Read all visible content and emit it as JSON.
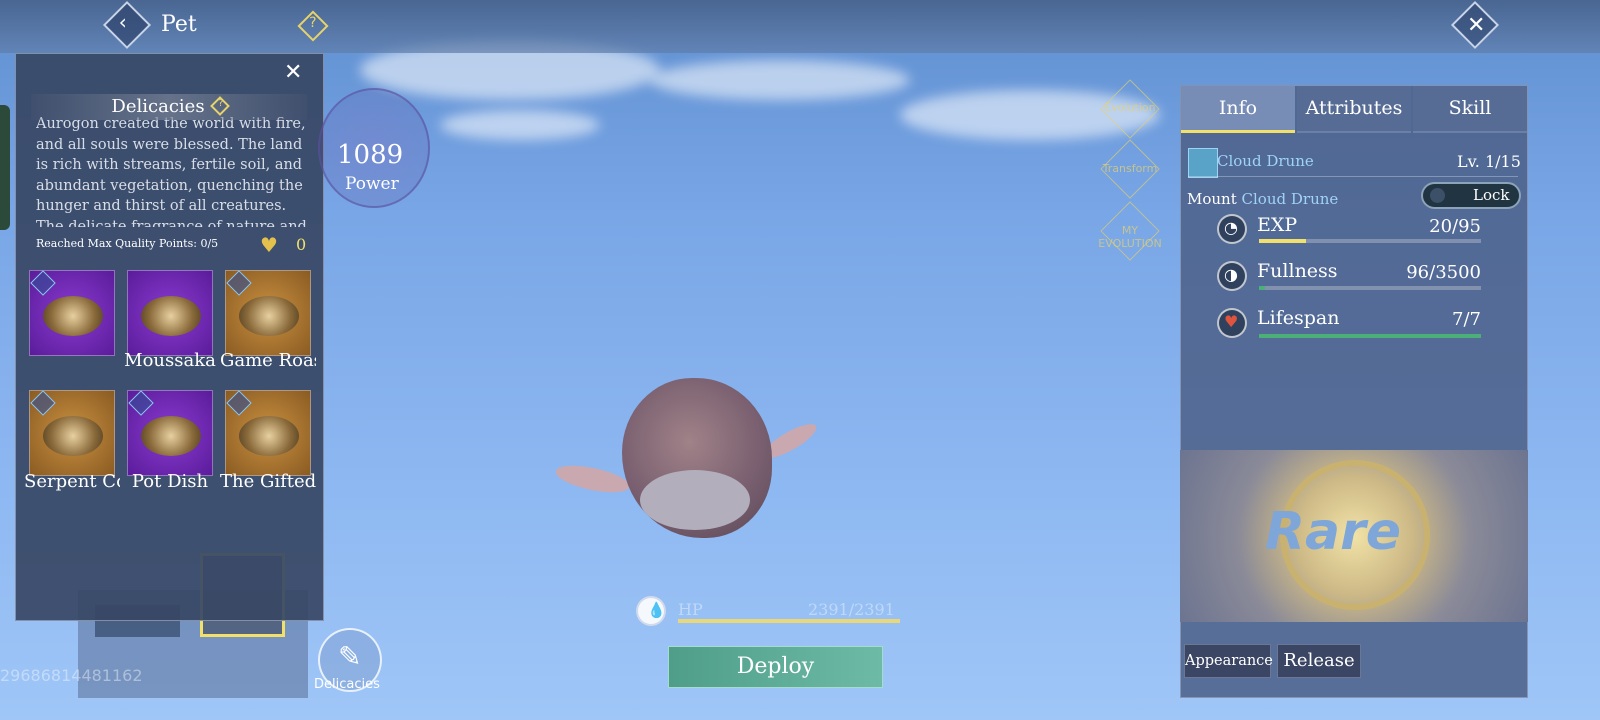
{
  "header": {
    "title": "Pet",
    "back_icon": "chevron-left-icon",
    "help_icon": "question-icon",
    "close_icon": "close-icon"
  },
  "delicacies_panel": {
    "title": "Delicacies",
    "lore": "Aurogon created the world with fire, and all souls were blessed. The land is rich with streams, fertile soil, and abundant vegetation, quenching the hunger and thirst of all creatures. The delicate fragrance of nature and",
    "quality_text": "Reached Max Quality Points: 0/5",
    "quality_count": "0",
    "items": [
      {
        "label": "",
        "rarity": "purple"
      },
      {
        "label": "Moussaka",
        "rarity": "purple"
      },
      {
        "label": "Game Roaste",
        "rarity": "orange"
      },
      {
        "label": "Serpent Core",
        "rarity": "orange"
      },
      {
        "label": "Pot Dish",
        "rarity": "purple"
      },
      {
        "label": "The Gifted",
        "rarity": "orange"
      }
    ]
  },
  "power": {
    "value": "1089",
    "label": "Power"
  },
  "side_icons": {
    "evolution": "Evolution",
    "transform": "Transform",
    "my_evolution": "MY EVOLUTION"
  },
  "pet_id": "29686814481162",
  "hp": {
    "label": "HP",
    "value": "2391/2391",
    "fraction": 1.0
  },
  "deploy_label": "Deploy",
  "delicacies_button_label": "Delicacies",
  "info_panel": {
    "tabs": [
      "Info",
      "Attributes",
      "Skill"
    ],
    "active_tab": "Info",
    "pet_name": "Cloud Drune",
    "level": "Lv. 1/15",
    "mount_label": "Mount",
    "mount_name": "Cloud Drune",
    "lock_label": "Lock",
    "stats": [
      {
        "name": "EXP",
        "value": "20/95",
        "fraction": 0.21,
        "color": "#f1e06a"
      },
      {
        "name": "Fullness",
        "value": "96/3500",
        "fraction": 0.027,
        "color": "#4caf78"
      },
      {
        "name": "Lifespan",
        "value": "7/7",
        "fraction": 1.0,
        "color": "#4caf78"
      }
    ],
    "rarity": "Rare",
    "appearance_label": "Appearance",
    "release_label": "Release"
  }
}
